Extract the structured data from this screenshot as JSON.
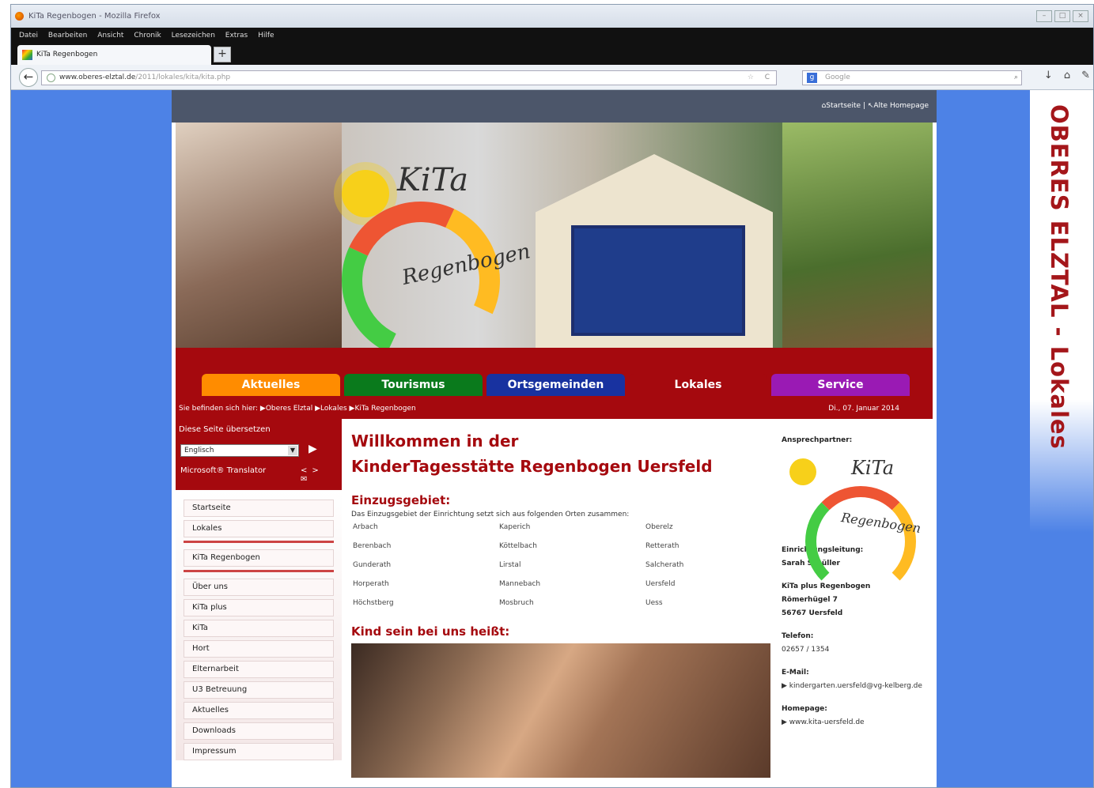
{
  "browser": {
    "window_title": "KiTa Regenbogen - Mozilla Firefox",
    "menu": [
      "Datei",
      "Bearbeiten",
      "Ansicht",
      "Chronik",
      "Lesezeichen",
      "Extras",
      "Hilfe"
    ],
    "tab_title": "KiTa Regenbogen",
    "new_tab": "+",
    "url_domain": "www.oberes-elztal.de",
    "url_path": "/2011/lokales/kita/kita.php",
    "search_placeholder": "Google"
  },
  "side_banner": "OBERES ELZTAL - Lokales",
  "topbar": {
    "home_label": "Startseite",
    "separator": "|",
    "old_home_label": "Alte Homepage"
  },
  "header": {
    "logo_line1": "KiTa",
    "logo_line2": "Regenbogen"
  },
  "nav": [
    {
      "label": "Aktuelles",
      "color": "#ff8c00"
    },
    {
      "label": "Tourismus",
      "color": "#0a7a1c"
    },
    {
      "label": "Ortsgemeinden",
      "color": "#1832a0"
    },
    {
      "label": "Lokales",
      "color": "#a5090e"
    },
    {
      "label": "Service",
      "color": "#9a1ab4"
    }
  ],
  "breadcrumb": "Sie befinden sich hier: ▶Oberes Elztal ▶Lokales ▶KiTa Regenbogen",
  "date": "Di., 07. Januar 2014",
  "translator": {
    "title": "Diese Seite übersetzen",
    "language": "Englisch",
    "brand": "Microsoft® Translator",
    "go": "▶",
    "tools": "<> ✉"
  },
  "sidemenu": {
    "group1": [
      "Startseite",
      "Lokales"
    ],
    "group2": [
      "KiTa Regenbogen"
    ],
    "group3": [
      "Über uns",
      "KiTa plus",
      "KiTa",
      "Hort",
      "Elternarbeit",
      "U3 Betreuung",
      "Aktuelles",
      "Downloads",
      "Impressum"
    ]
  },
  "main": {
    "title_line1": "Willkommen in der",
    "title_line2": "KinderTagesstätte Regenbogen Uersfeld",
    "section1": "Einzugsgebiet:",
    "intro": "Das Einzugsgebiet der Einrichtung setzt sich aus folgenden Orten zusammen:",
    "places": [
      "Arbach",
      "Kaperich",
      "Oberelz",
      "Berenbach",
      "Köttelbach",
      "Retterath",
      "Gunderath",
      "Lirstal",
      "Salcherath",
      "Horperath",
      "Mannebach",
      "Uersfeld",
      "Höchstberg",
      "Mosbruch",
      "Uess"
    ],
    "section2": "Kind sein bei uns heißt:"
  },
  "contact": {
    "title": "Ansprechpartner:",
    "logo_line1": "KiTa",
    "logo_line2": "Regenbogen",
    "lead_label": "Einrichtungsleitung:",
    "lead_name": "Sarah Schüller",
    "addr1": "KiTa plus Regenbogen",
    "addr2": "Römerhügel 7",
    "addr3": "56767 Uersfeld",
    "phone_label": "Telefon:",
    "phone": "02657 / 1354",
    "email_label": "E-Mail:",
    "email": "▶ kindergarten.uersfeld@vg-kelberg.de",
    "home_label": "Homepage:",
    "home": "▶ www.kita-uersfeld.de"
  }
}
